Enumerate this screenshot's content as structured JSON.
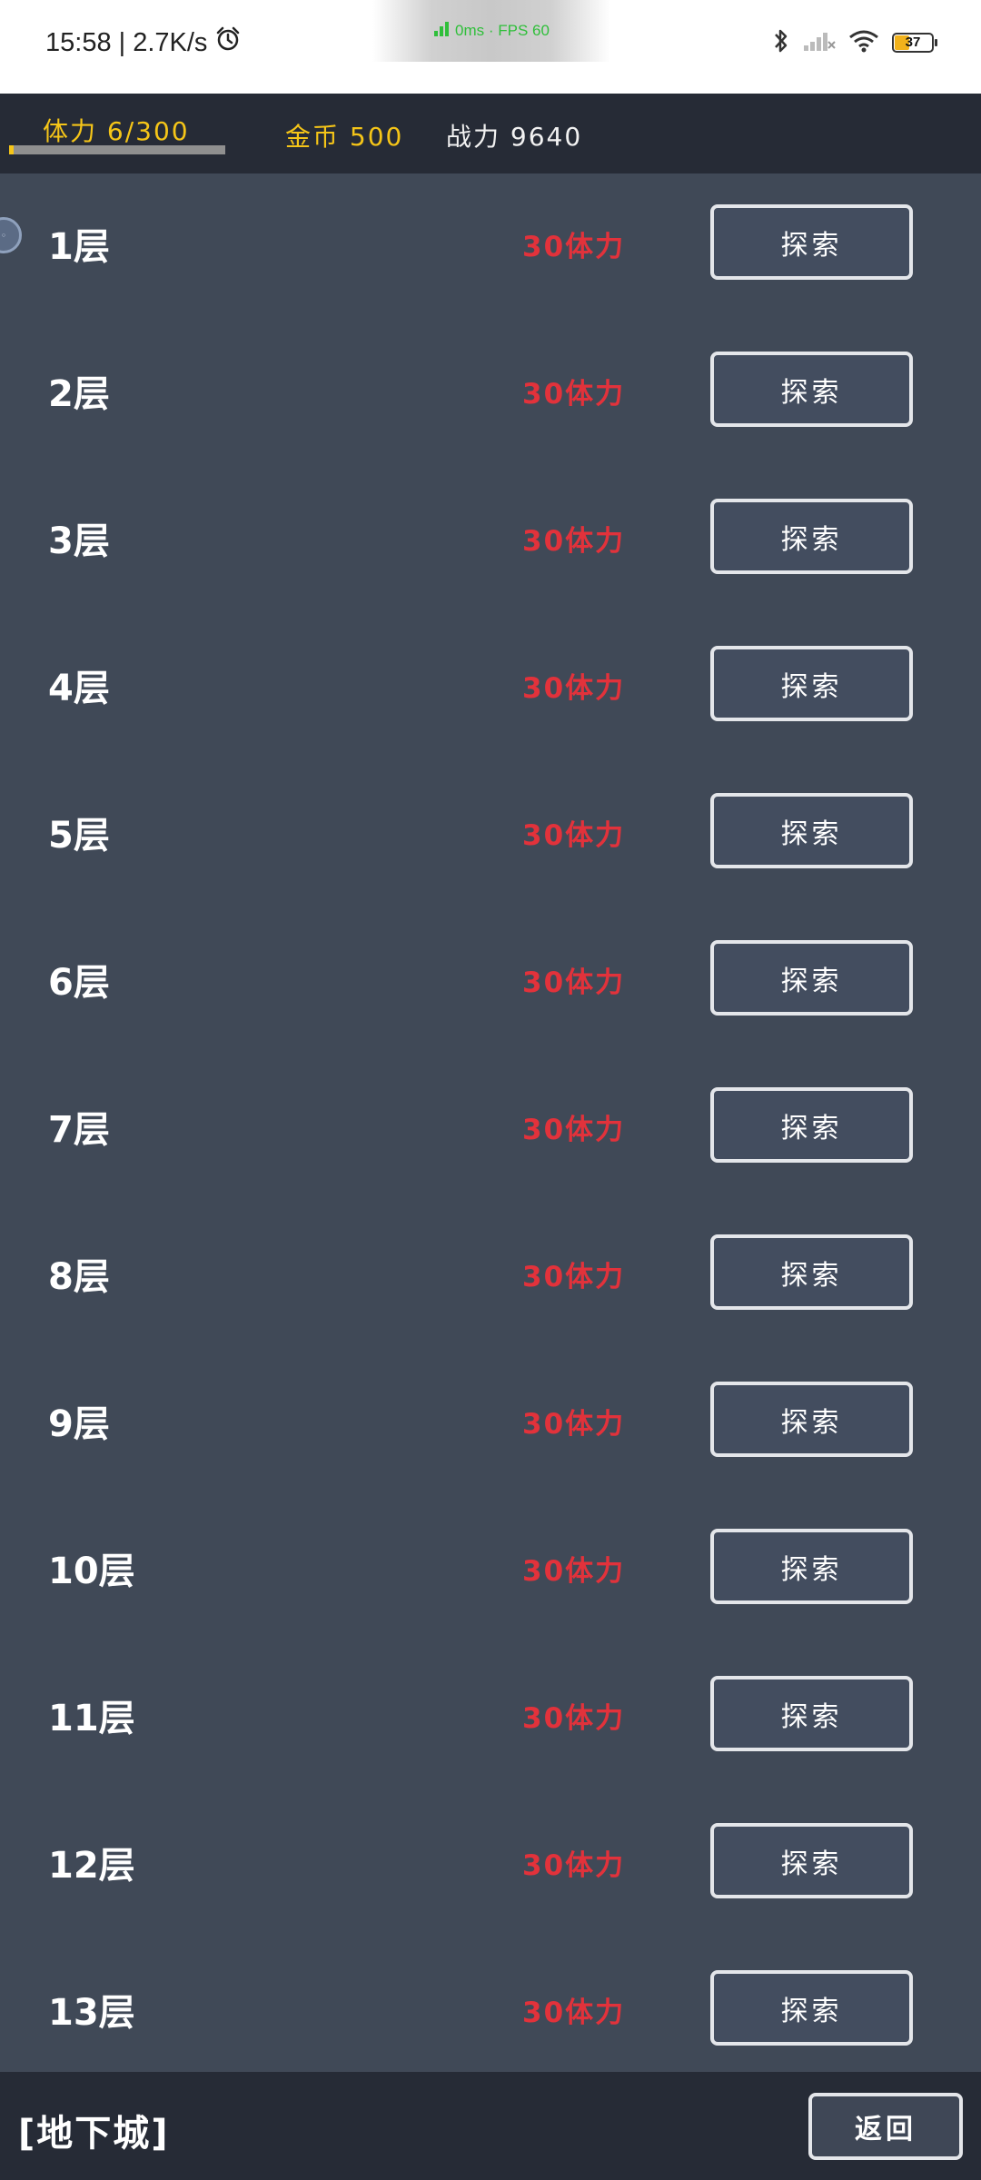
{
  "status_bar": {
    "time": "15:58 | 2.7K/s",
    "fps_text": "0ms · FPS 60",
    "battery_level": "37",
    "icons": [
      "alarm-icon",
      "bluetooth-icon",
      "cellular-signal-icon",
      "wifi-icon",
      "battery-icon"
    ]
  },
  "header": {
    "stamina_text": "体力 6/300",
    "stamina_fraction": 0.02,
    "gold_text": "金币 500",
    "power_text": "战力 9640"
  },
  "floors": [
    {
      "label": "1层",
      "cost": "30体力",
      "button": "探索"
    },
    {
      "label": "2层",
      "cost": "30体力",
      "button": "探索"
    },
    {
      "label": "3层",
      "cost": "30体力",
      "button": "探索"
    },
    {
      "label": "4层",
      "cost": "30体力",
      "button": "探索"
    },
    {
      "label": "5层",
      "cost": "30体力",
      "button": "探索"
    },
    {
      "label": "6层",
      "cost": "30体力",
      "button": "探索"
    },
    {
      "label": "7层",
      "cost": "30体力",
      "button": "探索"
    },
    {
      "label": "8层",
      "cost": "30体力",
      "button": "探索"
    },
    {
      "label": "9层",
      "cost": "30体力",
      "button": "探索"
    },
    {
      "label": "10层",
      "cost": "30体力",
      "button": "探索"
    },
    {
      "label": "11层",
      "cost": "30体力",
      "button": "探索"
    },
    {
      "label": "12层",
      "cost": "30体力",
      "button": "探索"
    },
    {
      "label": "13层",
      "cost": "30体力",
      "button": "探索"
    }
  ],
  "footer": {
    "title": "[地下城]",
    "back_label": "返回"
  },
  "colors": {
    "background": "#404957",
    "bar": "#262b36",
    "accent_yellow": "#f5c518",
    "cost_red": "#e2323b"
  }
}
